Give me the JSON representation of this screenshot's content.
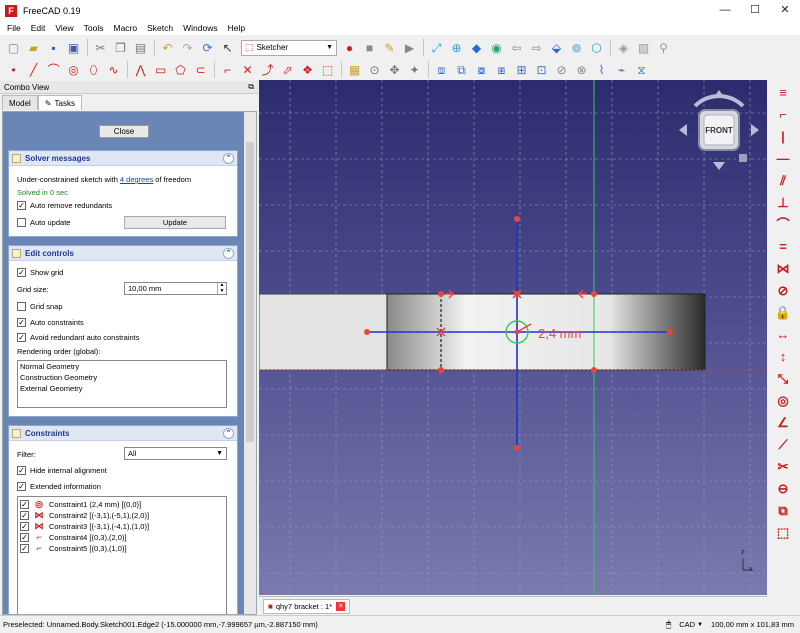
{
  "window": {
    "title": "FreeCAD 0.19",
    "logo_letter": "F",
    "min": "—",
    "max": "☐",
    "close": "✕"
  },
  "menu": [
    "File",
    "Edit",
    "View",
    "Tools",
    "Macro",
    "Sketch",
    "Windows",
    "Help"
  ],
  "workbench": {
    "selected": "Sketcher"
  },
  "combo_view": {
    "title": "Combo View",
    "tabs": [
      "Model",
      "Tasks"
    ],
    "close_label": "Close",
    "solver": {
      "title": "Solver messages",
      "msg_prefix": "Under-constrained sketch with ",
      "msg_link": "4 degrees",
      "msg_suffix": " of freedom",
      "solved": "Solved in 0 sec",
      "auto_remove": "Auto remove redundants",
      "auto_remove_checked": true,
      "auto_update": "Auto update",
      "auto_update_checked": false,
      "update_button": "Update"
    },
    "edit_controls": {
      "title": "Edit controls",
      "show_grid": "Show grid",
      "show_grid_checked": true,
      "grid_size_label": "Grid size:",
      "grid_size_value": "10,00 mm",
      "grid_snap": "Grid snap",
      "grid_snap_checked": false,
      "auto_constraints": "Auto constraints",
      "auto_constraints_checked": true,
      "avoid_redundant": "Avoid redundant auto constraints",
      "avoid_redundant_checked": true,
      "rendering_order_label": "Rendering order (global):",
      "rendering_order": [
        "Normal Geometry",
        "Construction Geometry",
        "External Geometry"
      ]
    },
    "constraints": {
      "title": "Constraints",
      "filter_label": "Filter:",
      "filter_value": "All",
      "hide_internal": "Hide internal alignment",
      "hide_internal_checked": true,
      "extended_info": "Extended information",
      "extended_info_checked": true,
      "items": [
        {
          "label": "Constraint1 (2,4 mm) [(0,0)]",
          "icon": "radius-constraint-icon",
          "glyph": "◎"
        },
        {
          "label": "Constraint2 [(-3,1),(-5,1),(2,0)]",
          "icon": "symmetric-constraint-icon",
          "glyph": "⋈"
        },
        {
          "label": "Constraint3 [(-3,1),(-4,1),(1,0)]",
          "icon": "symmetric-constraint-icon",
          "glyph": "⋈"
        },
        {
          "label": "Constraint4 [(0,3),(2,0)]",
          "icon": "point-on-object-icon",
          "glyph": "⌐"
        },
        {
          "label": "Constraint5 [(0,3),(1,0)]",
          "icon": "point-on-object-icon",
          "glyph": "⌐"
        }
      ]
    }
  },
  "viewport": {
    "navcube_face": "FRONT",
    "dimension_label": "2,4 mm",
    "axis_z": "z",
    "axis_x": "x"
  },
  "document_tab": {
    "label": "qhy7 bracket : 1*",
    "close": "✕"
  },
  "status": {
    "preselected": "Preselected: Unnamed.Body.Sketch001.Edge2 (-15.000000 mm,-7.999657 µm,-2.887150 mm)",
    "nav_style": "CAD",
    "dimensions": "100,00 mm x 101,83 mm"
  },
  "colors": {
    "sketch_red": "#e8453c",
    "axis_blue": "#2233cc",
    "axis_green": "#33cc55",
    "brand_red": "#c81b1b"
  }
}
